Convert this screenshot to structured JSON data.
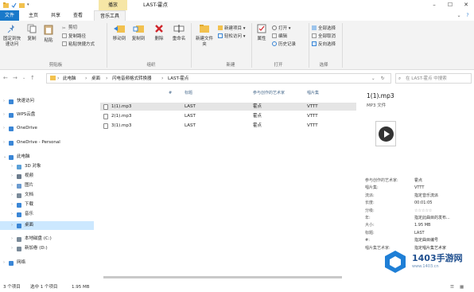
{
  "titlebar": {
    "play_tab": "播放",
    "title": "LAST-霍点"
  },
  "ribbon_tabs": {
    "file": "文件",
    "home": "主页",
    "share": "共享",
    "view": "查看",
    "music_tools": "音乐工具"
  },
  "ribbon": {
    "pin_label": "固定到快速访问",
    "copy": "复制",
    "paste": "粘贴",
    "cut": "剪切",
    "copy_path": "复制路径",
    "paste_shortcut": "粘贴快捷方式",
    "group_clipboard": "剪贴板",
    "move_to": "移动到",
    "copy_to": "复制到",
    "delete": "删除",
    "rename": "重命名",
    "group_organize": "组织",
    "new_folder": "新建文件夹",
    "new_item": "新建项目",
    "easy_access": "轻松访问",
    "group_new": "新建",
    "properties": "属性",
    "open": "打开",
    "edit": "编辑",
    "history": "历史记录",
    "group_open": "打开",
    "select_all": "全部选择",
    "select_none": "全部取消",
    "invert_selection": "反向选择",
    "group_select": "选择"
  },
  "address": {
    "crumbs": [
      "此电脑",
      "桌面",
      "闪电音频格式转换器",
      "LAST-霍点"
    ],
    "search_placeholder": "在 LAST-霍点 中搜索"
  },
  "navpane": {
    "items": [
      {
        "label": "快速访问",
        "icon": "star-icon",
        "color": "#3a86d6"
      },
      {
        "label": "WPS云盘",
        "icon": "cloud-icon",
        "color": "#3a86d6"
      },
      {
        "label": "OneDrive",
        "icon": "cloud-icon",
        "color": "#3a86d6"
      },
      {
        "label": "OneDrive - Personal",
        "icon": "cloud-icon",
        "color": "#3a86d6"
      },
      {
        "label": "此电脑",
        "icon": "computer-icon",
        "color": "#3a86d6"
      },
      {
        "label": "3D 对象",
        "icon": "cube-icon",
        "color": "#5aa0d8"
      },
      {
        "label": "视频",
        "icon": "video-icon",
        "color": "#6b7b8c"
      },
      {
        "label": "图片",
        "icon": "picture-icon",
        "color": "#6b9bd0"
      },
      {
        "label": "文档",
        "icon": "document-icon",
        "color": "#7a8a99"
      },
      {
        "label": "下载",
        "icon": "download-icon",
        "color": "#3a86d6"
      },
      {
        "label": "音乐",
        "icon": "music-icon",
        "color": "#3a86d6"
      },
      {
        "label": "桌面",
        "icon": "desktop-icon",
        "color": "#3a86d6"
      },
      {
        "label": "本地磁盘 (C:)",
        "icon": "drive-icon",
        "color": "#7a8a99"
      },
      {
        "label": "新加卷 (D:)",
        "icon": "drive-icon",
        "color": "#7a8a99"
      },
      {
        "label": "网络",
        "icon": "network-icon",
        "color": "#3a86d6"
      }
    ]
  },
  "table": {
    "headers": [
      "#",
      "标题",
      "参与创作的艺术家",
      "唱片集"
    ],
    "rows": [
      {
        "name": "1(1).mp3",
        "title": "LAST",
        "artist": "霍点",
        "album": "VTTT"
      },
      {
        "name": "2(1).mp3",
        "title": "LAST",
        "artist": "霍点",
        "album": "VTTT"
      },
      {
        "name": "3(1).mp3",
        "title": "LAST",
        "artist": "霍点",
        "album": "VTTT"
      }
    ]
  },
  "preview": {
    "filename": "1(1).mp3",
    "filetype": "MP3 文件",
    "props": [
      {
        "k": "参与创作的艺术家:",
        "v": "霍点"
      },
      {
        "k": "唱片集:",
        "v": "VTTT"
      },
      {
        "k": "流派:",
        "v": "指定音乐流派"
      },
      {
        "k": "长度:",
        "v": "00:01:05"
      },
      {
        "k": "分级:",
        "v": ""
      },
      {
        "k": "年:",
        "v": "指定此曲目的发布..."
      },
      {
        "k": "大小:",
        "v": "1.95 MB"
      },
      {
        "k": "标题:",
        "v": "LAST"
      },
      {
        "k": "#:",
        "v": "指定曲目编号"
      },
      {
        "k": "唱片集艺术家:",
        "v": "指定唱片集艺术家"
      }
    ]
  },
  "status": {
    "count": "3 个项目",
    "selected": "选中 1 个项目",
    "size": "1.95 MB"
  },
  "watermark": {
    "brand": "1403手游网",
    "url": "www.1403.cn"
  },
  "colors": {
    "accent": "#1979ca",
    "selection": "#cce8ff",
    "play_tab": "#f6e6a6"
  }
}
